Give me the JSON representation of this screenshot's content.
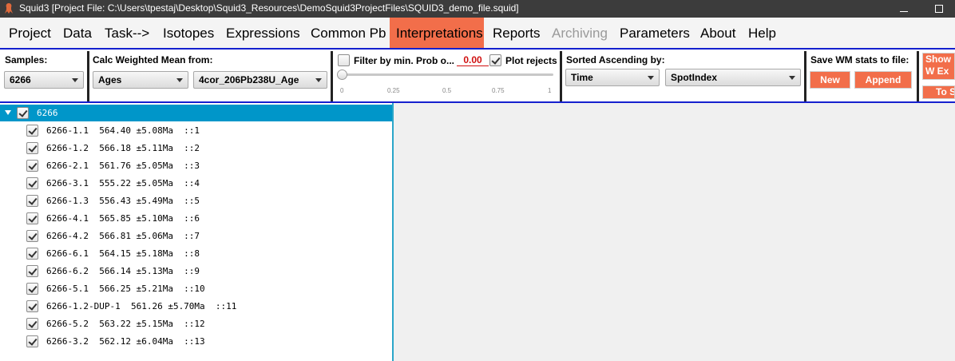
{
  "window": {
    "title": "Squid3  [Project File: C:\\Users\\tpestaj\\Desktop\\Squid3_Resources\\DemoSquid3ProjectFiles\\SQUID3_demo_file.squid]"
  },
  "menu": {
    "items": [
      {
        "label": "Project"
      },
      {
        "label": "Data"
      },
      {
        "label": "Task-->"
      },
      {
        "label": "Isotopes"
      },
      {
        "label": "Expressions"
      },
      {
        "label": "Common Pb"
      },
      {
        "label": "Interpretations",
        "state": "active"
      },
      {
        "label": "Reports"
      },
      {
        "label": "Archiving",
        "state": "disabled"
      },
      {
        "label": "Parameters"
      },
      {
        "label": "About"
      },
      {
        "label": "Help"
      }
    ],
    "active_color": "#f26e4a"
  },
  "toolbar": {
    "samples_label": "Samples:",
    "samples_value": "6266",
    "calc_label": "Calc Weighted Mean from:",
    "calc_source_value": "Ages",
    "calc_field_value": "4cor_206Pb238U_Age",
    "filter_label": "Filter by min. Prob o...",
    "filter_checked": false,
    "prob_value": "0.00",
    "plot_rejects_label": "Plot rejects",
    "plot_rejects_checked": true,
    "slider_value": 0,
    "slider_ticks": [
      "0",
      "0.25",
      "0.5",
      "0.75",
      "1"
    ],
    "sorted_label": "Sorted Ascending by:",
    "sort_primary_value": "Time",
    "sort_secondary_value": "SpotIndex",
    "save_label": "Save WM stats to file:",
    "new_button": "New",
    "append_button": "Append",
    "show_button": "Show W Expres",
    "to_button": "To S",
    "accent_color": "#f26e4a",
    "border_color": "#1520ce"
  },
  "tree": {
    "root_label": "6266",
    "root_checked": true,
    "rows": [
      {
        "text": "6266-1.1  564.40 ±5.08Ma  ::1",
        "checked": true
      },
      {
        "text": "6266-1.2  566.18 ±5.11Ma  ::2",
        "checked": true
      },
      {
        "text": "6266-2.1  561.76 ±5.05Ma  ::3",
        "checked": true
      },
      {
        "text": "6266-3.1  555.22 ±5.05Ma  ::4",
        "checked": true
      },
      {
        "text": "6266-1.3  556.43 ±5.49Ma  ::5",
        "checked": true
      },
      {
        "text": "6266-4.1  565.85 ±5.10Ma  ::6",
        "checked": true
      },
      {
        "text": "6266-4.2  566.81 ±5.06Ma  ::7",
        "checked": true
      },
      {
        "text": "6266-6.1  564.15 ±5.18Ma  ::8",
        "checked": true
      },
      {
        "text": "6266-6.2  566.14 ±5.13Ma  ::9",
        "checked": true
      },
      {
        "text": "6266-5.1  566.25 ±5.21Ma  ::10",
        "checked": true
      },
      {
        "text": "6266-1.2-DUP-1  561.26 ±5.70Ma  ::11",
        "checked": true
      },
      {
        "text": "6266-5.2  563.22 ±5.15Ma  ::12",
        "checked": true
      },
      {
        "text": "6266-3.2  562.12 ±6.04Ma  ::13",
        "checked": true
      }
    ],
    "selected_color": "#0096c9"
  }
}
